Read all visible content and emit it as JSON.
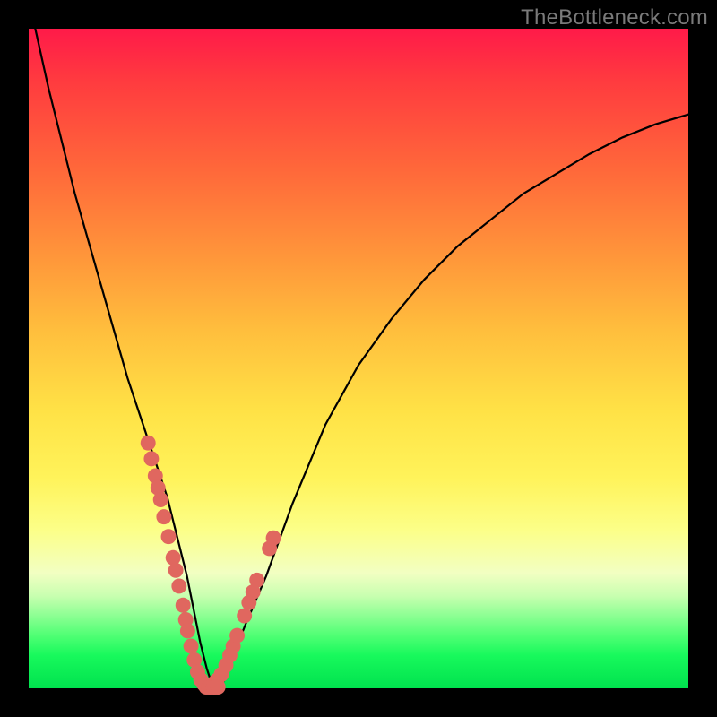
{
  "watermark": "TheBottleneck.com",
  "chart_data": {
    "type": "line",
    "title": "",
    "xlabel": "",
    "ylabel": "",
    "xlim": [
      0,
      100
    ],
    "ylim": [
      0,
      100
    ],
    "curve": {
      "name": "bottleneck-curve",
      "x": [
        1,
        3,
        5,
        7,
        9,
        11,
        13,
        15,
        17,
        19,
        21,
        22,
        23,
        24,
        25,
        26,
        27,
        28,
        29,
        30,
        31,
        33,
        36,
        40,
        45,
        50,
        55,
        60,
        65,
        70,
        75,
        80,
        85,
        90,
        95,
        100
      ],
      "y": [
        100,
        91,
        83,
        75,
        68,
        61,
        54,
        47,
        41,
        35,
        29,
        25,
        21,
        17,
        12,
        7,
        3,
        0,
        0,
        2,
        5,
        10,
        17,
        28,
        40,
        49,
        56,
        62,
        67,
        71,
        75,
        78,
        81,
        83.5,
        85.5,
        87
      ]
    },
    "scatter_left": {
      "name": "left-branch-points",
      "x": [
        18.1,
        18.6,
        19.2,
        19.6,
        20.0,
        20.5,
        21.2,
        21.9,
        22.3,
        22.8,
        23.4,
        23.8,
        24.1,
        24.6,
        25.1,
        25.6,
        26.1,
        26.6
      ],
      "y": [
        37.2,
        34.8,
        32.2,
        30.4,
        28.6,
        26.0,
        23.0,
        19.8,
        17.9,
        15.5,
        12.6,
        10.4,
        8.7,
        6.4,
        4.3,
        2.5,
        1.3,
        0.6
      ]
    },
    "scatter_right": {
      "name": "right-branch-points",
      "x": [
        27.8,
        28.5,
        29.2,
        29.9,
        30.5,
        31.0,
        31.6,
        32.7,
        33.4,
        34.0,
        34.6,
        36.5,
        37.1
      ],
      "y": [
        0.6,
        1.2,
        2.1,
        3.5,
        5.0,
        6.4,
        8.0,
        11.0,
        13.0,
        14.6,
        16.4,
        21.2,
        22.8
      ]
    },
    "scatter_bottom": {
      "name": "valley-floor-points",
      "x": [
        26.9,
        27.3,
        27.6,
        28.0,
        28.3,
        28.7
      ],
      "y": [
        0.2,
        0.2,
        0.2,
        0.2,
        0.2,
        0.2
      ]
    },
    "dot_radius_percent": 1.15
  }
}
